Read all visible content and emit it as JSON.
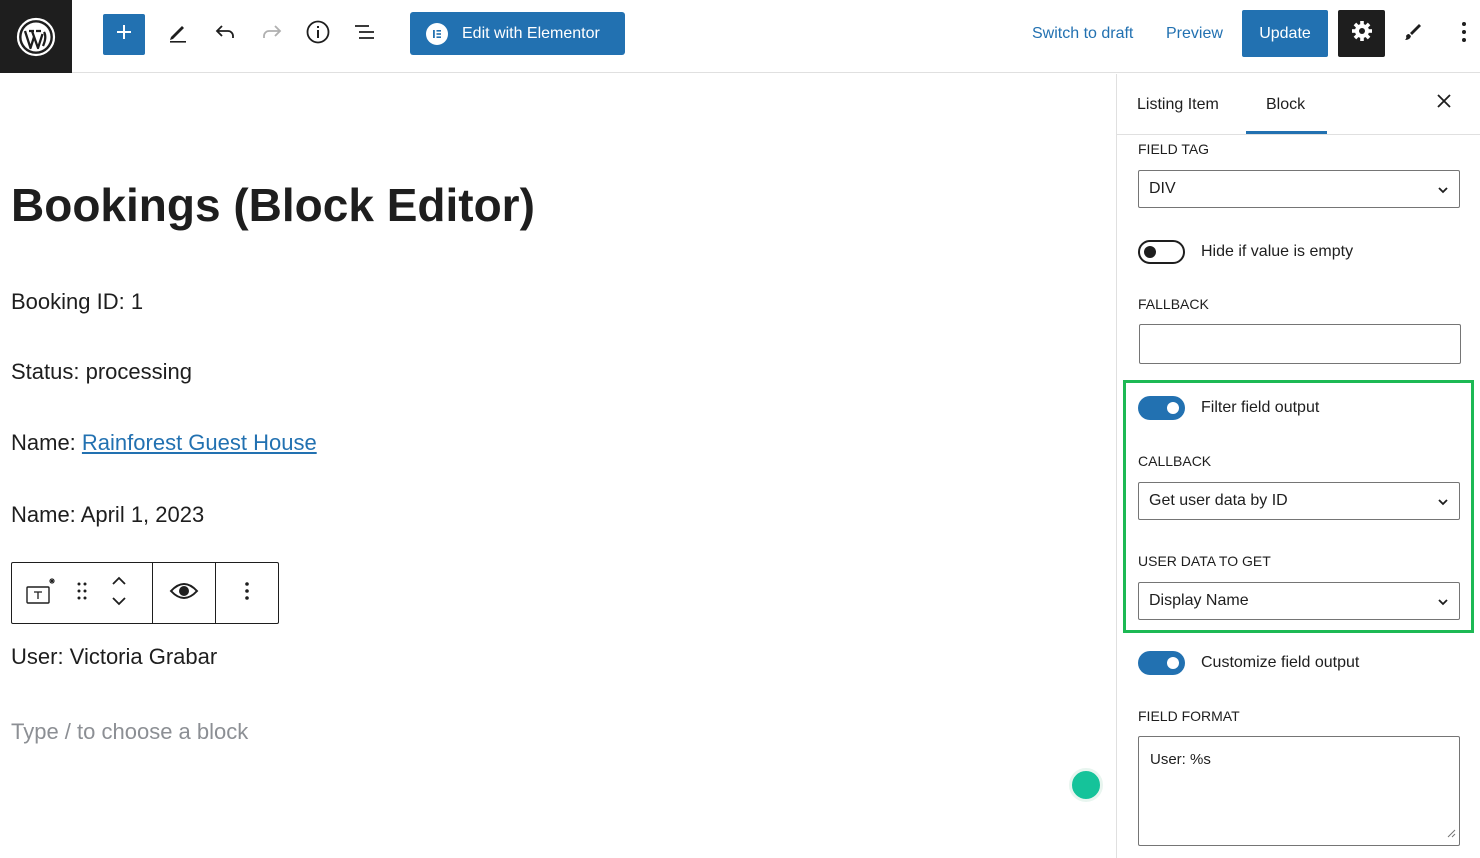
{
  "toolbar": {
    "edit_elementor_label": "Edit with Elementor",
    "switch_draft_label": "Switch to draft",
    "preview_label": "Preview",
    "update_label": "Update"
  },
  "editor": {
    "post_title": "Bookings (Block Editor)",
    "booking_id": "Booking ID: 1",
    "status": "Status: processing",
    "name_prefix": "Name: ",
    "name_link": "Rainforest Guest House",
    "name_date": "Name: April 1, 2023",
    "user": "User: Victoria Grabar",
    "block_placeholder": "Type / to choose a block"
  },
  "sidebar": {
    "tab_listing": "Listing Item",
    "tab_block": "Block",
    "field_tag_label": "FIELD TAG",
    "field_tag_value": "DIV",
    "hide_empty_label": "Hide if value is empty",
    "hide_empty_on": false,
    "fallback_label": "FALLBACK",
    "fallback_value": "",
    "filter_output_label": "Filter field output",
    "filter_output_on": true,
    "callback_label": "CALLBACK",
    "callback_value": "Get user data by ID",
    "user_data_label": "USER DATA TO GET",
    "user_data_value": "Display Name",
    "customize_output_label": "Customize field output",
    "customize_output_on": true,
    "field_format_label": "FIELD FORMAT",
    "field_format_value": "User: %s"
  },
  "colors": {
    "accent": "#2271b1",
    "highlight": "#1db954",
    "dark": "#1e1e1e"
  },
  "icons": [
    "wordpress-logo-icon",
    "plus-icon",
    "pencil-icon",
    "undo-icon",
    "redo-icon",
    "info-icon",
    "list-view-icon",
    "elementor-icon",
    "gear-icon",
    "brush-icon",
    "more-vertical-icon",
    "close-icon",
    "chevron-down-icon",
    "dynamic-field-icon",
    "drag-handle-icon",
    "move-up-down-icon",
    "eye-icon",
    "resize-grip-icon",
    "grammarly-icon"
  ]
}
